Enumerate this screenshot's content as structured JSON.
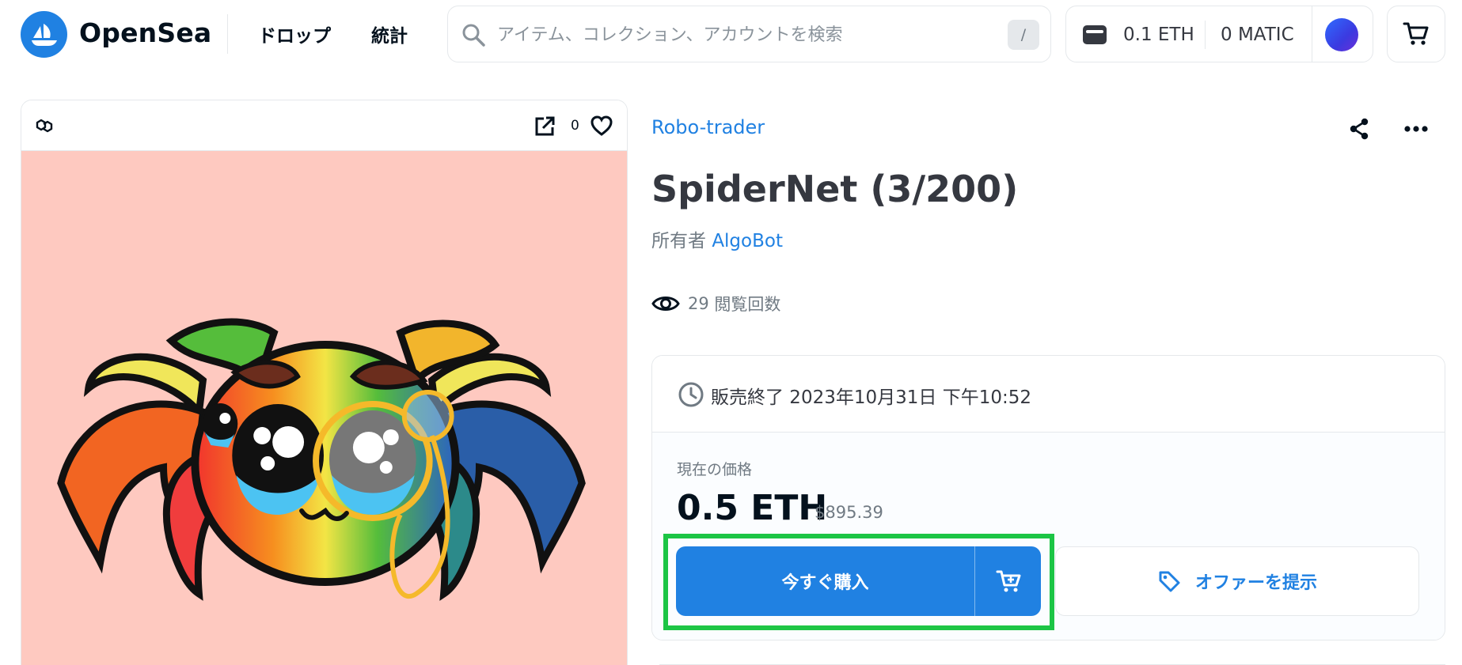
{
  "header": {
    "brand": "OpenSea",
    "nav": {
      "drops": "ドロップ",
      "stats": "統計"
    },
    "search": {
      "placeholder": "アイテム、コレクション、アカウントを検索",
      "shortcut": "/"
    },
    "wallet": {
      "eth_balance": "0.1 ETH",
      "matic_balance": "0 MATIC"
    },
    "icons": [
      "opensea-logo-icon",
      "search-icon",
      "wallet-icon",
      "cart-icon"
    ]
  },
  "item_panel": {
    "favorite_count": "0",
    "icons": [
      "polygon-chain-icon",
      "external-link-icon",
      "heart-icon"
    ],
    "background_color": "#fec9c0"
  },
  "item": {
    "collection": "Robo-trader",
    "title": "SpiderNet (3/200)",
    "owner_prefix": "所有者",
    "owner": "AlgoBot",
    "views_count": "29",
    "views_label": "閲覧回数",
    "icons": [
      "share-icon",
      "more-icon",
      "eye-icon"
    ]
  },
  "sale": {
    "end_text": "販売終了 2023年10月31日 下午10:52",
    "price_label": "現在の価格",
    "price": "0.5 ETH",
    "price_usd": "$895.39",
    "buy_label": "今すぐ購入",
    "offer_label": "オファーを提示",
    "icons": [
      "clock-icon",
      "add-to-cart-icon",
      "tag-icon"
    ]
  },
  "colors": {
    "accent": "#2081e2",
    "highlight": "#1cc545",
    "text_dark": "#04111d",
    "text_muted": "#707a83"
  }
}
